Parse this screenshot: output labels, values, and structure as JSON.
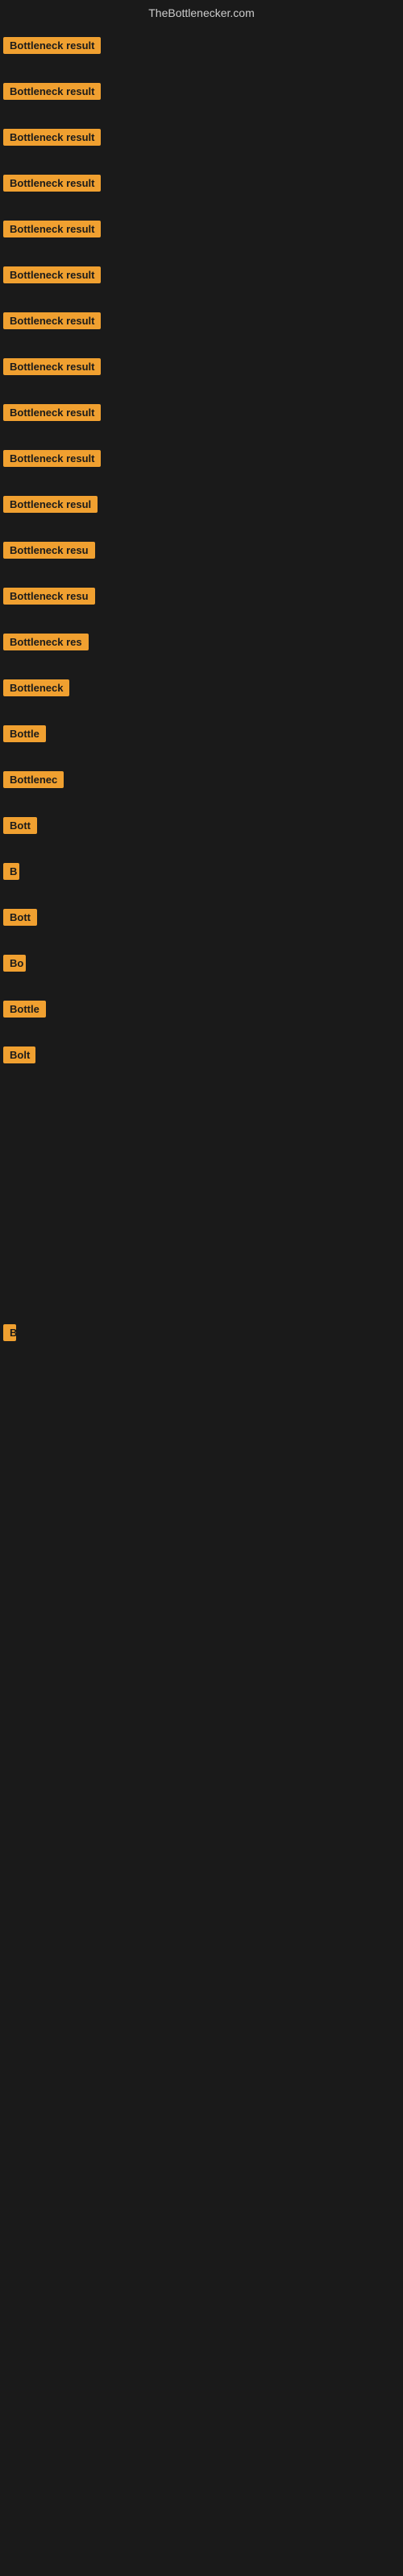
{
  "header": {
    "title": "TheBottlenecker.com"
  },
  "accent_color": "#f0a030",
  "background_color": "#1a1a1a",
  "rows": [
    {
      "id": 1,
      "label": "Bottleneck result",
      "clip_width": 155
    },
    {
      "id": 2,
      "label": "Bottleneck result",
      "clip_width": 155
    },
    {
      "id": 3,
      "label": "Bottleneck result",
      "clip_width": 155
    },
    {
      "id": 4,
      "label": "Bottleneck result",
      "clip_width": 155
    },
    {
      "id": 5,
      "label": "Bottleneck result",
      "clip_width": 155
    },
    {
      "id": 6,
      "label": "Bottleneck result",
      "clip_width": 155
    },
    {
      "id": 7,
      "label": "Bottleneck result",
      "clip_width": 155
    },
    {
      "id": 8,
      "label": "Bottleneck result",
      "clip_width": 152
    },
    {
      "id": 9,
      "label": "Bottleneck result",
      "clip_width": 152
    },
    {
      "id": 10,
      "label": "Bottleneck result",
      "clip_width": 150
    },
    {
      "id": 11,
      "label": "Bottleneck resul",
      "clip_width": 140
    },
    {
      "id": 12,
      "label": "Bottleneck resu",
      "clip_width": 132
    },
    {
      "id": 13,
      "label": "Bottleneck resu",
      "clip_width": 130
    },
    {
      "id": 14,
      "label": "Bottleneck res",
      "clip_width": 122
    },
    {
      "id": 15,
      "label": "Bottleneck",
      "clip_width": 95
    },
    {
      "id": 16,
      "label": "Bottle",
      "clip_width": 60
    },
    {
      "id": 17,
      "label": "Bottlenec",
      "clip_width": 80
    },
    {
      "id": 18,
      "label": "Bott",
      "clip_width": 45
    },
    {
      "id": 19,
      "label": "B",
      "clip_width": 20
    },
    {
      "id": 20,
      "label": "Bott",
      "clip_width": 45
    },
    {
      "id": 21,
      "label": "Bo",
      "clip_width": 28
    },
    {
      "id": 22,
      "label": "Bottle",
      "clip_width": 60
    },
    {
      "id": 23,
      "label": "Bolt",
      "clip_width": 40
    },
    {
      "id": 24,
      "label": "",
      "clip_width": 0
    },
    {
      "id": 25,
      "label": "",
      "clip_width": 0
    },
    {
      "id": 26,
      "label": "",
      "clip_width": 0
    },
    {
      "id": 27,
      "label": "",
      "clip_width": 0
    },
    {
      "id": 28,
      "label": "",
      "clip_width": 0
    },
    {
      "id": 29,
      "label": "",
      "clip_width": 0
    },
    {
      "id": 30,
      "label": "",
      "clip_width": 0
    },
    {
      "id": 31,
      "label": "",
      "clip_width": 0
    },
    {
      "id": 32,
      "label": "B",
      "clip_width": 14
    }
  ]
}
